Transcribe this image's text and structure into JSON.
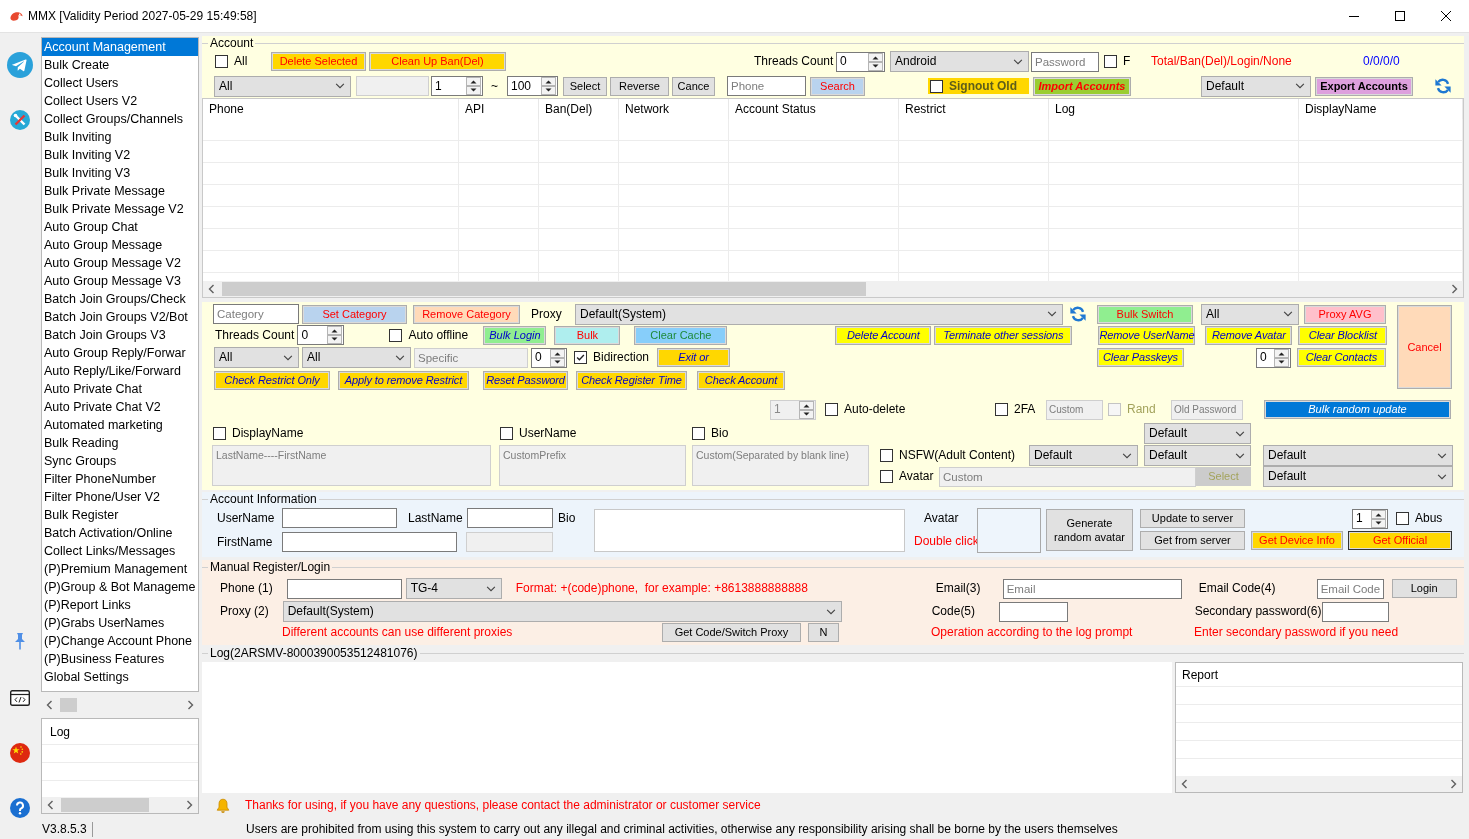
{
  "window": {
    "title": "MMX [Validity Period 2027-05-29 15:49:58]"
  },
  "sidebar": {
    "items": [
      {
        "label": "Account Management",
        "selected": true
      },
      {
        "label": "Bulk Create",
        "selected": false
      },
      {
        "label": "Collect Users",
        "selected": false
      },
      {
        "label": "Collect Users V2",
        "selected": false
      },
      {
        "label": "Collect Groups/Channels",
        "selected": false
      },
      {
        "label": "Bulk Inviting",
        "selected": false
      },
      {
        "label": "Bulk Inviting V2",
        "selected": false
      },
      {
        "label": "Bulk Inviting V3",
        "selected": false
      },
      {
        "label": "Bulk Private Message",
        "selected": false
      },
      {
        "label": "Bulk Private Message V2",
        "selected": false
      },
      {
        "label": "Auto Group Chat",
        "selected": false
      },
      {
        "label": "Auto Group Message",
        "selected": false
      },
      {
        "label": "Auto Group Message V2",
        "selected": false
      },
      {
        "label": "Auto Group Message V3",
        "selected": false
      },
      {
        "label": "Batch Join Groups/Check",
        "selected": false
      },
      {
        "label": "Batch Join Groups V2/Bot",
        "selected": false
      },
      {
        "label": "Batch Join Groups V3",
        "selected": false
      },
      {
        "label": "Auto Group Reply/Forwar",
        "selected": false
      },
      {
        "label": "Auto Reply/Like/Forward",
        "selected": false
      },
      {
        "label": "Auto Private Chat",
        "selected": false
      },
      {
        "label": "Auto Private Chat V2",
        "selected": false
      },
      {
        "label": "Automated marketing",
        "selected": false
      },
      {
        "label": "Bulk Reading",
        "selected": false
      },
      {
        "label": "Sync Groups",
        "selected": false
      },
      {
        "label": "Filter PhoneNumber",
        "selected": false
      },
      {
        "label": "Filter Phone/User V2",
        "selected": false
      },
      {
        "label": "Bulk Register",
        "selected": false
      },
      {
        "label": "Batch Activation/Online",
        "selected": false
      },
      {
        "label": "Collect Links/Messages",
        "selected": false
      },
      {
        "label": "(P)Premium Management",
        "selected": false
      },
      {
        "label": "(P)Group & Bot Manageme",
        "selected": false
      },
      {
        "label": "(P)Report Links",
        "selected": false
      },
      {
        "label": "(P)Grabs UserNames",
        "selected": false
      },
      {
        "label": "(P)Change Account Phone",
        "selected": false
      },
      {
        "label": "(P)Business Features",
        "selected": false
      },
      {
        "label": "Global Settings",
        "selected": false
      }
    ],
    "log_header": "Log"
  },
  "account": {
    "title": "Account",
    "controls": [
      {
        "kind": "checkbox",
        "label": "All",
        "checked": false,
        "disabled": false
      },
      {
        "kind": "button",
        "label": "Delete Selected",
        "disabled": false
      },
      {
        "kind": "button",
        "label": "Clean Up Ban(Del)",
        "disabled": false
      },
      {
        "kind": "label",
        "text": "Threads Count"
      },
      {
        "kind": "spinner",
        "value": "0",
        "disabled": false
      },
      {
        "kind": "select",
        "value": "Android",
        "disabled": false
      },
      {
        "kind": "input",
        "placeholder": "Password",
        "disabled": false
      },
      {
        "kind": "checkbox",
        "label": "F",
        "checked": false,
        "disabled": false
      },
      {
        "kind": "note",
        "text": "Total/Ban(Del)/Login/None"
      },
      {
        "kind": "note",
        "text": "0/0/0/0"
      },
      {
        "kind": "select",
        "value": "All",
        "disabled": false
      },
      {
        "kind": "input",
        "disabled": true
      },
      {
        "kind": "spinner",
        "value": "1",
        "disabled": false
      },
      {
        "kind": "label",
        "text": "~"
      },
      {
        "kind": "spinner",
        "value": "100",
        "disabled": false
      },
      {
        "kind": "button",
        "label": "Select",
        "disabled": false
      },
      {
        "kind": "button",
        "label": "Reverse",
        "disabled": false
      },
      {
        "kind": "button",
        "label": "Cance",
        "disabled": false
      },
      {
        "kind": "input",
        "placeholder": "Phone",
        "disabled": false
      },
      {
        "kind": "button",
        "label": "Search",
        "disabled": false
      },
      {
        "kind": "checkbox",
        "label": "Signout Old",
        "checked": false,
        "disabled": false
      },
      {
        "kind": "button",
        "label": "Import Accounts",
        "disabled": false
      },
      {
        "kind": "select",
        "value": "Default",
        "disabled": false
      },
      {
        "kind": "button",
        "label": "Export Accounts",
        "disabled": false
      }
    ]
  },
  "accounts_table": {
    "columns": [
      "Phone",
      "API",
      "Ban(Del)",
      "Network",
      "Account Status",
      "Restrict",
      "Log",
      "DisplayName"
    ]
  },
  "batch": {
    "controls": [
      {
        "kind": "input",
        "placeholder": "Category",
        "disabled": false
      },
      {
        "kind": "button",
        "label": "Set Category",
        "disabled": false
      },
      {
        "kind": "button",
        "label": "Remove Category",
        "disabled": false
      },
      {
        "kind": "label",
        "text": "Proxy"
      },
      {
        "kind": "select",
        "value": "Default(System)",
        "disabled": false
      },
      {
        "kind": "button",
        "label": "Bulk Switch",
        "disabled": false
      },
      {
        "kind": "select",
        "value": "All",
        "disabled": false
      },
      {
        "kind": "button",
        "label": "Proxy AVG",
        "disabled": false
      },
      {
        "kind": "button",
        "label": "Cancel",
        "disabled": false
      },
      {
        "kind": "label",
        "text": "Threads Count"
      },
      {
        "kind": "spinner",
        "value": "0",
        "disabled": false
      },
      {
        "kind": "checkbox",
        "label": "Auto offline",
        "checked": false,
        "disabled": false
      },
      {
        "kind": "button",
        "label": "Bulk Login",
        "disabled": false
      },
      {
        "kind": "button",
        "label": "Bulk",
        "disabled": false
      },
      {
        "kind": "button",
        "label": "Clear Cache",
        "disabled": false
      },
      {
        "kind": "button",
        "label": "Delete Account",
        "disabled": false
      },
      {
        "kind": "button",
        "label": "Terminate other sessions",
        "disabled": false
      },
      {
        "kind": "button",
        "label": "Remove UserName",
        "disabled": false
      },
      {
        "kind": "button",
        "label": "Remove Avatar",
        "disabled": false
      },
      {
        "kind": "button",
        "label": "Clear Blocklist",
        "disabled": false
      },
      {
        "kind": "select",
        "value": "All",
        "disabled": false
      },
      {
        "kind": "select",
        "value": "All",
        "disabled": false
      },
      {
        "kind": "input",
        "placeholder": "Specific",
        "disabled": true
      },
      {
        "kind": "spinner",
        "value": "0",
        "disabled": false
      },
      {
        "kind": "checkbox",
        "label": "Bidirection",
        "checked": true,
        "disabled": false
      },
      {
        "kind": "button",
        "label": "Exit or",
        "disabled": false
      },
      {
        "kind": "button",
        "label": "Clear Passkeys",
        "disabled": false
      },
      {
        "kind": "spinner",
        "value": "0",
        "disabled": false
      },
      {
        "kind": "button",
        "label": "Clear Contacts",
        "disabled": false
      },
      {
        "kind": "button",
        "label": "Check Restrict Only",
        "disabled": false
      },
      {
        "kind": "button",
        "label": "Apply to remove Restrict",
        "disabled": false
      },
      {
        "kind": "button",
        "label": "Reset Password",
        "disabled": false
      },
      {
        "kind": "button",
        "label": "Check Register Time",
        "disabled": false
      },
      {
        "kind": "button",
        "label": "Check Account",
        "disabled": false
      },
      {
        "kind": "spinner",
        "value": "1",
        "disabled": true
      },
      {
        "kind": "checkbox",
        "label": "Auto-delete",
        "checked": false,
        "disabled": false
      },
      {
        "kind": "checkbox",
        "label": "2FA",
        "checked": false,
        "disabled": false
      },
      {
        "kind": "input",
        "placeholder": "Custom",
        "disabled": true
      },
      {
        "kind": "checkbox",
        "label": "Rand",
        "checked": false,
        "disabled": true
      },
      {
        "kind": "input",
        "placeholder": "Old Password",
        "disabled": true
      },
      {
        "kind": "button",
        "label": "Bulk random update",
        "disabled": false
      },
      {
        "kind": "checkbox",
        "label": "DisplayName",
        "checked": false,
        "disabled": false
      },
      {
        "kind": "checkbox",
        "label": "UserName",
        "checked": false,
        "disabled": false
      },
      {
        "kind": "checkbox",
        "label": "Bio",
        "checked": false,
        "disabled": false
      },
      {
        "kind": "select",
        "value": "Default",
        "disabled": false
      },
      {
        "kind": "textarea",
        "placeholder": "LastName----FirstName",
        "disabled": true
      },
      {
        "kind": "textarea",
        "placeholder": "CustomPrefix",
        "disabled": true
      },
      {
        "kind": "textarea",
        "placeholder": "Custom(Separated by blank line)",
        "disabled": true
      },
      {
        "kind": "checkbox",
        "label": "NSFW(Adult Content)",
        "checked": false,
        "disabled": false
      },
      {
        "kind": "select",
        "value": "Default",
        "disabled": false
      },
      {
        "kind": "select",
        "value": "Default",
        "disabled": false
      },
      {
        "kind": "select",
        "value": "Default",
        "disabled": false
      },
      {
        "kind": "checkbox",
        "label": "Avatar",
        "checked": false,
        "disabled": false
      },
      {
        "kind": "input",
        "placeholder": "Custom",
        "disabled": true
      },
      {
        "kind": "button",
        "label": "Select",
        "disabled": true
      },
      {
        "kind": "select",
        "value": "Default",
        "disabled": false
      }
    ]
  },
  "account_information": {
    "title": "Account Information",
    "controls": [
      {
        "kind": "label",
        "text": "UserName"
      },
      {
        "kind": "input",
        "disabled": false
      },
      {
        "kind": "label",
        "text": "LastName"
      },
      {
        "kind": "input",
        "disabled": false
      },
      {
        "kind": "label",
        "text": "Bio"
      },
      {
        "kind": "textarea",
        "disabled": false
      },
      {
        "kind": "label",
        "text": "Avatar"
      },
      {
        "kind": "button",
        "label": "Generate random avatar",
        "disabled": false
      },
      {
        "kind": "button",
        "label": "Update to server",
        "disabled": false
      },
      {
        "kind": "spinner",
        "value": "1",
        "disabled": false
      },
      {
        "kind": "checkbox",
        "label": "Abus",
        "checked": false,
        "disabled": false
      },
      {
        "kind": "label",
        "text": "FirstName"
      },
      {
        "kind": "input",
        "disabled": false
      },
      {
        "kind": "input",
        "disabled": true
      },
      {
        "kind": "note",
        "text": "Double click"
      },
      {
        "kind": "button",
        "label": "Get from server",
        "disabled": false
      },
      {
        "kind": "button",
        "label": "Get Device Info",
        "disabled": false
      },
      {
        "kind": "button",
        "label": "Get Official",
        "disabled": false
      }
    ]
  },
  "manual_register": {
    "title": "Manual Register/Login",
    "controls": [
      {
        "kind": "label",
        "text": "Phone (1)"
      },
      {
        "kind": "input"
      },
      {
        "kind": "select",
        "value": "TG-4"
      },
      {
        "kind": "note",
        "text": "Format: +(code)phone,  for example: +8613888888888"
      },
      {
        "kind": "label",
        "text": "Email(3)"
      },
      {
        "kind": "input",
        "placeholder": "Email"
      },
      {
        "kind": "label",
        "text": "Email Code(4)"
      },
      {
        "kind": "input",
        "placeholder": "Email Code"
      },
      {
        "kind": "button",
        "label": "Login"
      },
      {
        "kind": "label",
        "text": "Proxy (2)"
      },
      {
        "kind": "select",
        "value": "Default(System)"
      },
      {
        "kind": "label",
        "text": "Code(5)"
      },
      {
        "kind": "input"
      },
      {
        "kind": "label",
        "text": "Secondary password(6)"
      },
      {
        "kind": "input"
      },
      {
        "kind": "note",
        "text": "Different accounts can use different proxies"
      },
      {
        "kind": "button",
        "label": "Get Code/Switch Proxy"
      },
      {
        "kind": "button",
        "label": "N"
      },
      {
        "kind": "note",
        "text": "Operation according to the log prompt"
      },
      {
        "kind": "note",
        "text": "Enter secondary password if you need"
      }
    ]
  },
  "log_panel": {
    "title": "Log(2ARSMV-8000390053512481076)"
  },
  "report_list": {
    "header": "Report"
  },
  "notice": {
    "text": "Thanks for using, if you have any questions, please contact the administrator or customer service"
  },
  "status_bar": {
    "version": "V3.8.5.3",
    "message": "Users are prohibited from using this system to carry out any illegal and criminal activities, otherwise any responsibility arising shall be borne by the users themselves"
  }
}
